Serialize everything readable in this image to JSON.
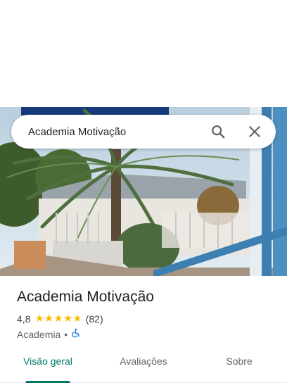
{
  "search": {
    "query": "Academia Motivação"
  },
  "place": {
    "name": "Academia Motivação",
    "rating": "4,8",
    "stars": 5,
    "reviews_count": "(82)",
    "category": "Academia",
    "separator": "•"
  },
  "photo_sign_text": "",
  "tabs": [
    {
      "label": "Visão geral",
      "active": true
    },
    {
      "label": "Avaliações",
      "active": false
    },
    {
      "label": "Sobre",
      "active": false
    }
  ],
  "icons": {
    "search": "search-icon",
    "close": "close-icon",
    "accessibility": "wheelchair-icon",
    "star": "star-icon"
  },
  "colors": {
    "accent": "#00796b",
    "star": "#fbbc04",
    "accessibility": "#1a73e8"
  }
}
